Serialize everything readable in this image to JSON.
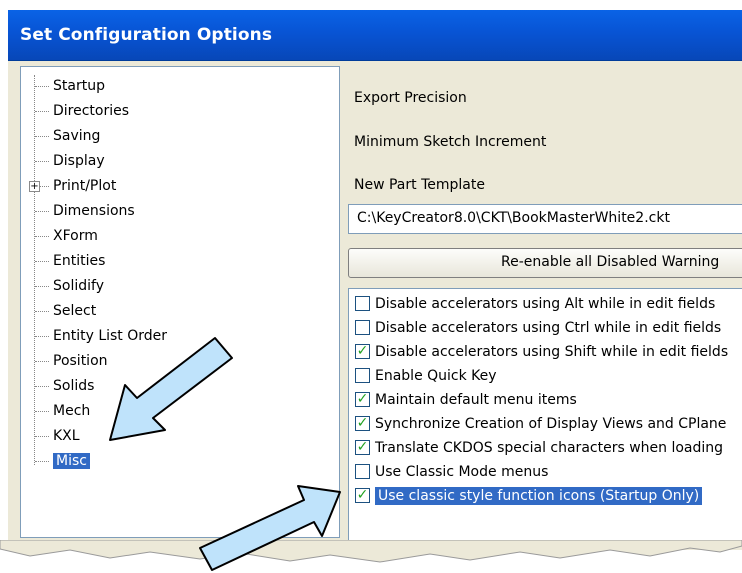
{
  "window": {
    "title": "Set Configuration Options"
  },
  "tree": {
    "items": [
      {
        "label": "Startup"
      },
      {
        "label": "Directories"
      },
      {
        "label": "Saving"
      },
      {
        "label": "Display"
      },
      {
        "label": "Print/Plot",
        "expander": "+"
      },
      {
        "label": "Dimensions"
      },
      {
        "label": "XForm"
      },
      {
        "label": "Entities"
      },
      {
        "label": "Solidify"
      },
      {
        "label": "Select"
      },
      {
        "label": "Entity List Order"
      },
      {
        "label": "Position"
      },
      {
        "label": "Solids"
      },
      {
        "label": "Mech"
      },
      {
        "label": "KXL"
      },
      {
        "label": "Misc",
        "selected": true
      }
    ]
  },
  "settings": {
    "export_precision_label": "Export Precision",
    "min_sketch_increment_label": "Minimum Sketch Increment",
    "new_part_template_label": "New Part Template",
    "new_part_template_value": "C:\\KeyCreator8.0\\CKT\\BookMasterWhite2.ckt",
    "reenable_button_label": "Re-enable all Disabled Warning"
  },
  "options": [
    {
      "label": "Disable accelerators using Alt while in edit fields",
      "checked": false
    },
    {
      "label": "Disable accelerators using Ctrl while in edit fields",
      "checked": false
    },
    {
      "label": "Disable accelerators using Shift while in edit fields",
      "checked": true
    },
    {
      "label": "Enable Quick Key",
      "checked": false
    },
    {
      "label": "Maintain default menu items",
      "checked": true
    },
    {
      "label": "Synchronize Creation of Display Views and CPlane",
      "checked": true
    },
    {
      "label": "Translate CKDOS special characters when loading",
      "checked": true
    },
    {
      "label": "Use Classic Mode menus",
      "checked": false
    },
    {
      "label": "Use classic style function icons (Startup Only)",
      "checked": true,
      "selected": true
    }
  ],
  "colors": {
    "titlebar": "#0a5be0",
    "selection": "#316ac5",
    "arrow_fill": "#bfe3fb",
    "check_mark": "#21a121"
  }
}
